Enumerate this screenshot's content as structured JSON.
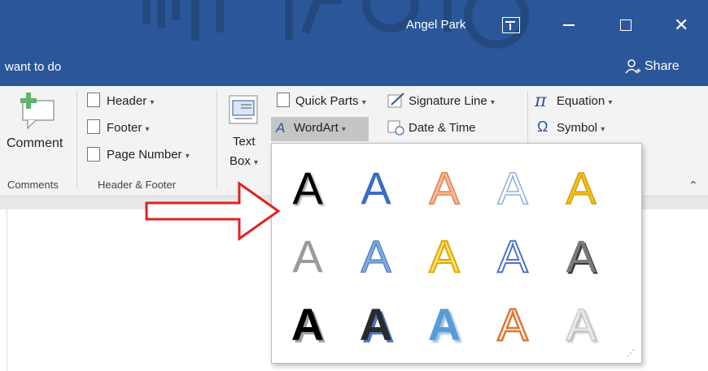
{
  "titlebar": {
    "user_name": "Angel Park",
    "close_glyph": "✕"
  },
  "tellbar": {
    "tell_me_text": "want to do",
    "share_label": "Share"
  },
  "ribbon": {
    "comment_label": "Comment",
    "comments_group": "Comments",
    "header_label": "Header",
    "footer_label": "Footer",
    "page_number_label": "Page Number",
    "header_footer_group": "Header & Footer",
    "textbox_line1": "Text",
    "textbox_line2": "Box",
    "quick_parts_label": "Quick Parts",
    "wordart_label": "WordArt",
    "signature_line_label": "Signature Line",
    "date_time_label": "Date & Time",
    "equation_label": "Equation",
    "symbol_label": "Symbol",
    "pi_glyph": "π",
    "omega_glyph": "Ω",
    "dropdown_glyph": "▾",
    "collapse_glyph": "⌃"
  },
  "gallery": {
    "letter": "A",
    "grip": "⋰"
  },
  "colors": {
    "accent": "#2b579a",
    "arrow_red": "#e02020"
  }
}
